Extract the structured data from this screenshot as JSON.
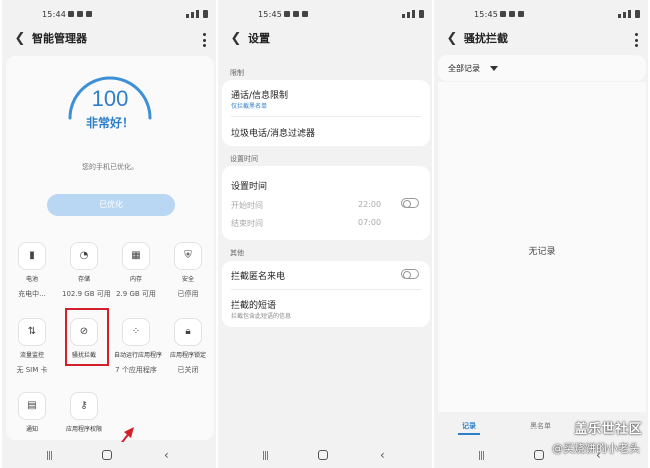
{
  "status_bar": {
    "time": "15:44",
    "time2": "15:45",
    "time3": "15:45"
  },
  "panel1": {
    "title": "智能管理器",
    "score": "100",
    "status": "非常好！",
    "message": "您的手机已优化。",
    "button": "已优化",
    "tiles": [
      {
        "label": "电池",
        "value": "充电中...",
        "icon": "battery-icon"
      },
      {
        "label": "存储",
        "value": "102.9 GB 可用",
        "icon": "storage-icon"
      },
      {
        "label": "内存",
        "value": "2.9 GB 可用",
        "icon": "memory-icon"
      },
      {
        "label": "安全",
        "value": "已停用",
        "icon": "shield-icon"
      },
      {
        "label": "流量监控",
        "value": "无 SIM 卡",
        "icon": "data-usage-icon"
      },
      {
        "label": "骚扰拦截",
        "value": "",
        "icon": "block-icon"
      },
      {
        "label": "自动运行应用程序",
        "value": "7 个应用程序",
        "icon": "autorun-icon"
      },
      {
        "label": "应用程序锁定",
        "value": "已关闭",
        "icon": "lock-icon"
      },
      {
        "label": "通知",
        "value": "",
        "icon": "notification-icon"
      },
      {
        "label": "应用程序权限",
        "value": "",
        "icon": "permission-icon"
      }
    ],
    "accent_color": "#2e7fc9",
    "highlight_color": "#d4202a"
  },
  "panel2": {
    "title": "设置",
    "section_restrict": "限制",
    "call_msg_limit": "通话/信息限制",
    "call_msg_limit_sub": "仅拦截黑名单",
    "spam_filter": "垃圾电话/消息过滤器",
    "section_time": "设置时间",
    "set_time": "设置时间",
    "start_time_label": "开始时间",
    "start_time_value": "22:00",
    "end_time_label": "结束时间",
    "end_time_value": "07:00",
    "section_other": "其他",
    "block_anonymous": "拦截匿名来电",
    "blocked_sms": "拦截的短语",
    "blocked_sms_sub": "拦截包含此短语的信息"
  },
  "panel3": {
    "title": "骚扰拦截",
    "filter": "全部记录",
    "empty": "无记录",
    "tab_records": "记录",
    "tab_blacklist": "黑名单"
  },
  "watermark": {
    "line1": "盖乐世社区",
    "line2": "@买烧饼的小老头"
  }
}
